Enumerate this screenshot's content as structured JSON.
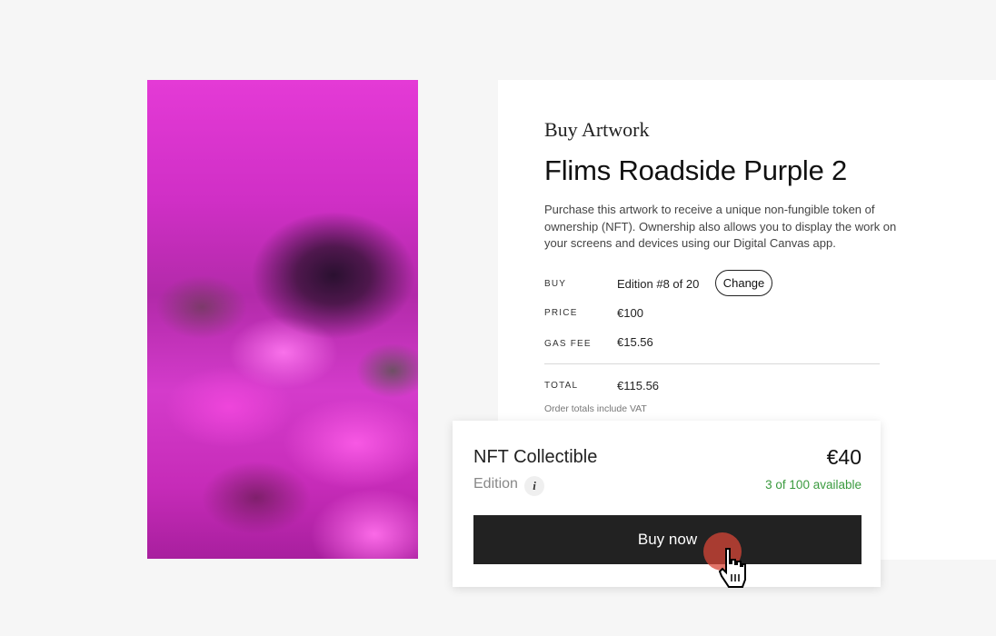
{
  "artwork": {
    "image_icon": "purple-flowers-photo"
  },
  "panel": {
    "eyebrow": "Buy Artwork",
    "title": "Flims Roadside Purple 2",
    "description": "Purchase this artwork to receive a unique non-fungible token of ownership (NFT). Ownership also allows you to display the work on your screens and devices using our Digital Canvas app.",
    "buy": {
      "label": "BUY",
      "value": "Edition #8 of 20",
      "change_label": "Change"
    },
    "price": {
      "label": "PRICE",
      "value": "€100"
    },
    "gas_fee": {
      "label": "GAS FEE",
      "value": "€15.56"
    },
    "total": {
      "label": "TOTAL",
      "value": "€115.56"
    },
    "vat_note": "Order totals include VAT"
  },
  "card": {
    "title": "NFT Collectible",
    "price": "€40",
    "edition_label": "Edition",
    "info_icon": "i",
    "availability": "3 of 100 available",
    "buy_label": "Buy now"
  },
  "colors": {
    "availability": "#3a9a3e",
    "button_bg": "#222222",
    "click_indicator": "#d74637"
  }
}
